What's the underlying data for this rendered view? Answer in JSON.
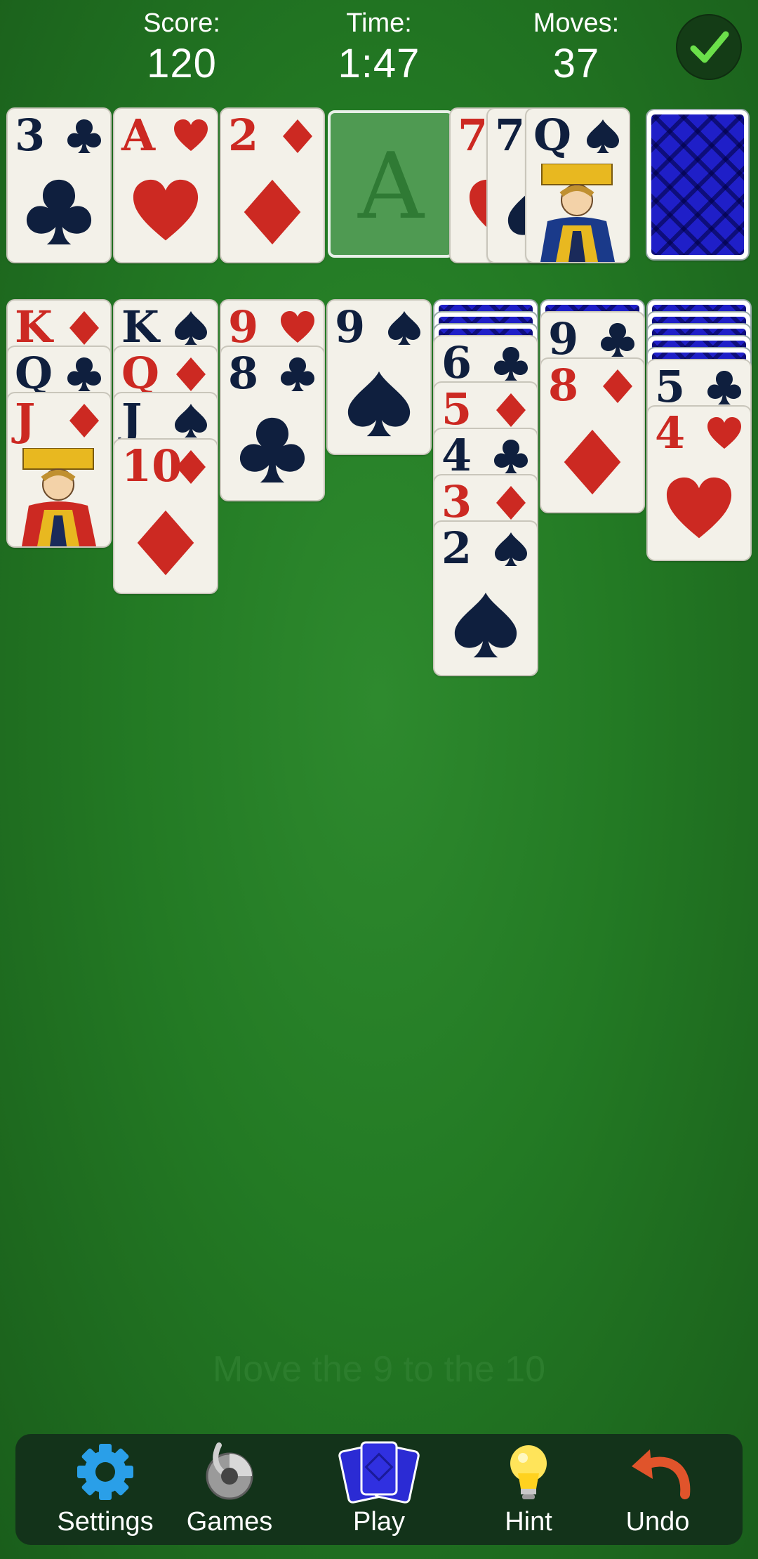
{
  "header": {
    "score_label": "Score:",
    "score_value": "120",
    "time_label": "Time:",
    "time_value": "1:47",
    "moves_label": "Moves:",
    "moves_value": "37"
  },
  "foundations": [
    {
      "rank": "3",
      "suit": "club"
    },
    {
      "rank": "A",
      "suit": "heart"
    },
    {
      "rank": "2",
      "suit": "diamond"
    }
  ],
  "empty_foundation_label": "A",
  "waste": [
    {
      "rank": "7",
      "suit": "heart"
    },
    {
      "rank": "7",
      "suit": "spade"
    },
    {
      "rank": "Q",
      "suit": "spade"
    }
  ],
  "tableau": [
    {
      "face_down": 0,
      "cards": [
        {
          "rank": "K",
          "suit": "diamond"
        },
        {
          "rank": "Q",
          "suit": "club"
        },
        {
          "rank": "J",
          "suit": "diamond"
        }
      ]
    },
    {
      "face_down": 0,
      "cards": [
        {
          "rank": "K",
          "suit": "spade"
        },
        {
          "rank": "Q",
          "suit": "diamond"
        },
        {
          "rank": "J",
          "suit": "spade"
        },
        {
          "rank": "10",
          "suit": "diamond"
        }
      ]
    },
    {
      "face_down": 0,
      "cards": [
        {
          "rank": "9",
          "suit": "heart"
        },
        {
          "rank": "8",
          "suit": "club"
        }
      ]
    },
    {
      "face_down": 0,
      "cards": [
        {
          "rank": "9",
          "suit": "spade"
        }
      ]
    },
    {
      "face_down": 3,
      "cards": [
        {
          "rank": "6",
          "suit": "club"
        },
        {
          "rank": "5",
          "suit": "diamond"
        },
        {
          "rank": "4",
          "suit": "club"
        },
        {
          "rank": "3",
          "suit": "diamond"
        },
        {
          "rank": "2",
          "suit": "spade"
        }
      ]
    },
    {
      "face_down": 1,
      "cards": [
        {
          "rank": "9",
          "suit": "club"
        },
        {
          "rank": "8",
          "suit": "diamond"
        }
      ]
    },
    {
      "face_down": 5,
      "cards": [
        {
          "rank": "5",
          "suit": "club"
        },
        {
          "rank": "4",
          "suit": "heart"
        }
      ]
    }
  ],
  "hint_text": "Move the 9 to the 10",
  "toolbar": {
    "settings_label": "Settings",
    "games_label": "Games",
    "play_label": "Play",
    "hint_label": "Hint",
    "undo_label": "Undo"
  },
  "colors": {
    "felt": "#237a24",
    "red_suit": "#cc2922",
    "black_suit": "#0f1f3e",
    "card_back": "#1f1fc8",
    "toolbar_bg": "#13331a"
  },
  "icons": [
    "checkmark-icon",
    "gear-icon",
    "games-icon",
    "play-cards-icon",
    "lightbulb-icon",
    "undo-arrow-icon"
  ]
}
